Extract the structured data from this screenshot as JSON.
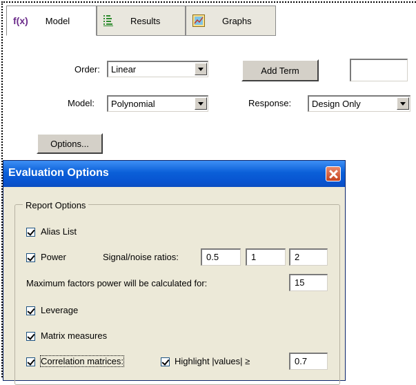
{
  "tabs": [
    {
      "icon_text": "f(x)",
      "label": "Model",
      "icon": "function-icon",
      "active": true
    },
    {
      "label": "Results",
      "icon": "results-list-icon",
      "active": false
    },
    {
      "label": "Graphs",
      "icon": "graph-icon",
      "active": false
    }
  ],
  "model_panel": {
    "order_label": "Order:",
    "order_value": "Linear",
    "add_term_label": "Add Term",
    "add_term_field_value": "",
    "model_label": "Model:",
    "model_value": "Polynomial",
    "response_label": "Response:",
    "response_value": "Design Only",
    "options_label": "Options..."
  },
  "dialog": {
    "title": "Evaluation Options",
    "group_label": "Report Options",
    "alias_list_label": "Alias List",
    "alias_list_checked": true,
    "power_label": "Power",
    "power_checked": true,
    "signal_noise_label": "Signal/noise ratios:",
    "signal_noise_values": [
      "0.5",
      "1",
      "2"
    ],
    "max_factors_label": "Maximum factors power will be calculated for:",
    "max_factors_value": "15",
    "leverage_label": "Leverage",
    "leverage_checked": true,
    "matrix_measures_label": "Matrix measures",
    "matrix_measures_checked": true,
    "correlation_label": "Correlation matrices:",
    "correlation_checked": true,
    "highlight_label": "Highlight |values| ≥",
    "highlight_checked": true,
    "highlight_value": "0.7"
  },
  "colors": {
    "titlebar": "#0a5fd8",
    "dialog_bg": "#ece9d8",
    "fx_purple": "#6b2b8a"
  }
}
